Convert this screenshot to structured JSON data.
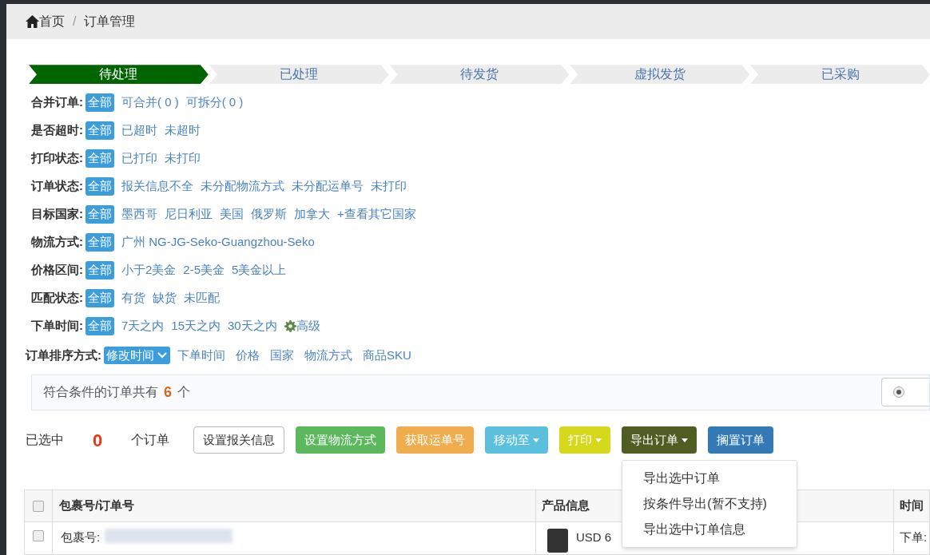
{
  "breadcrumb": [
    {
      "label": "首页",
      "kind": "home"
    },
    {
      "label": "订单管理",
      "kind": "page"
    }
  ],
  "breadcrumb_separator": "/",
  "steps": [
    {
      "label": "待处理",
      "selected": true
    },
    {
      "label": "已处理",
      "selected": false
    },
    {
      "label": "待发货",
      "selected": false
    },
    {
      "label": "虚拟发货",
      "selected": false
    },
    {
      "label": "已采购",
      "selected": false
    }
  ],
  "filters": [
    {
      "label": "合并订单:",
      "options": [
        {
          "label": "全部",
          "selected": true
        },
        {
          "label": "可合并( 0 )",
          "selected": false
        },
        {
          "label": "可拆分( 0 )",
          "selected": false
        }
      ]
    },
    {
      "label": "是否超时:",
      "options": [
        {
          "label": "全部",
          "selected": true
        },
        {
          "label": "已超时",
          "selected": false
        },
        {
          "label": "未超时",
          "selected": false
        }
      ]
    },
    {
      "label": "打印状态:",
      "options": [
        {
          "label": "全部",
          "selected": true
        },
        {
          "label": "已打印",
          "selected": false
        },
        {
          "label": "未打印",
          "selected": false
        }
      ]
    },
    {
      "label": "订单状态:",
      "options": [
        {
          "label": "全部",
          "selected": true
        },
        {
          "label": "报关信息不全",
          "selected": false
        },
        {
          "label": "未分配物流方式",
          "selected": false
        },
        {
          "label": "未分配运单号",
          "selected": false
        },
        {
          "label": "未打印",
          "selected": false
        }
      ]
    },
    {
      "label": "目标国家:",
      "options": [
        {
          "label": "全部",
          "selected": true
        },
        {
          "label": "墨西哥",
          "selected": false
        },
        {
          "label": "尼日利亚",
          "selected": false
        },
        {
          "label": "美国",
          "selected": false
        },
        {
          "label": "俄罗斯",
          "selected": false
        },
        {
          "label": "加拿大",
          "selected": false
        },
        {
          "label": "+查看其它国家",
          "selected": false
        }
      ]
    },
    {
      "label": "物流方式:",
      "options": [
        {
          "label": "全部",
          "selected": true
        },
        {
          "label": "广州 NG-JG-Seko-Guangzhou-Seko",
          "selected": false
        }
      ]
    },
    {
      "label": "价格区间:",
      "options": [
        {
          "label": "全部",
          "selected": true
        },
        {
          "label": "小于2美金",
          "selected": false
        },
        {
          "label": "2-5美金",
          "selected": false
        },
        {
          "label": "5美金以上",
          "selected": false
        }
      ]
    },
    {
      "label": "匹配状态:",
      "options": [
        {
          "label": "全部",
          "selected": true
        },
        {
          "label": "有货",
          "selected": false
        },
        {
          "label": "缺货",
          "selected": false
        },
        {
          "label": "未匹配",
          "selected": false
        }
      ]
    },
    {
      "label": "下单时间:",
      "options": [
        {
          "label": "全部",
          "selected": true
        },
        {
          "label": "7天之内",
          "selected": false
        },
        {
          "label": "15天之内",
          "selected": false
        },
        {
          "label": "30天之内",
          "selected": false
        }
      ],
      "advanced": "高级"
    }
  ],
  "sort": {
    "label": "订单排序方式:",
    "options": [
      {
        "label": "修改时间",
        "selected": true
      },
      {
        "label": "下单时间",
        "selected": false
      },
      {
        "label": "价格",
        "selected": false
      },
      {
        "label": "国家",
        "selected": false
      },
      {
        "label": "物流方式",
        "selected": false
      },
      {
        "label": "商品SKU",
        "selected": false
      }
    ]
  },
  "summary": {
    "prefix": "符合条件的订单共有",
    "count": "6",
    "suffix": "个",
    "radio_checked": true
  },
  "selection": {
    "prefix": "已选中",
    "count": "0",
    "suffix": "个订单"
  },
  "actions": [
    {
      "label": "设置报关信息",
      "color": "#ffffff",
      "dropdown": false
    },
    {
      "label": "设置物流方式",
      "color": "#5cb85c",
      "dropdown": false
    },
    {
      "label": "获取运单号",
      "color": "#f0ad4e",
      "dropdown": false
    },
    {
      "label": "移动至",
      "color": "#5bc0de",
      "dropdown": true
    },
    {
      "label": "打印",
      "color": "#d6d81c",
      "dropdown": true
    },
    {
      "label": "导出订单",
      "color": "#4f5d23",
      "dropdown": true
    },
    {
      "label": "搁置订单",
      "color": "#337ab7",
      "dropdown": false
    }
  ],
  "export_menu": [
    "导出选中订单",
    "按条件导出(暂不支持)",
    "导出选中订单信息"
  ],
  "table": {
    "header_checked": false,
    "columns": [
      "包裹号/订单号",
      "产品信息",
      "时间"
    ],
    "rows": [
      {
        "checked": false,
        "package_label": "包裹号:",
        "price": "USD 6",
        "time": "下单:"
      }
    ]
  }
}
